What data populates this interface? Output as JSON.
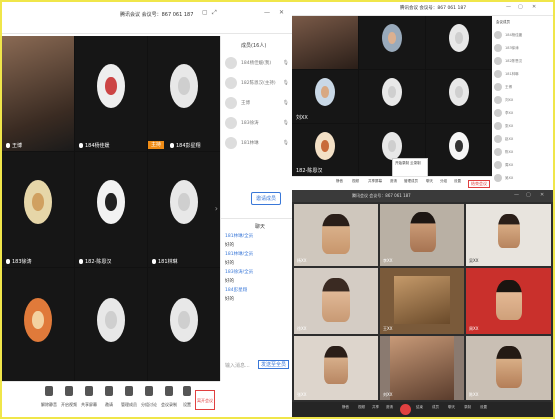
{
  "left_window": {
    "title": "腾讯会议 会议号：867 061 187",
    "controls": [
      "▢",
      "⤢",
      "—",
      "✕"
    ],
    "tiles": [
      {
        "name": "王博"
      },
      {
        "name": "184杨佳媛"
      },
      {
        "name": "184彭星翔"
      },
      {
        "name": "183徐涛"
      },
      {
        "name": "182-陈恩汉"
      },
      {
        "name": "181林琳"
      },
      {
        "name": ""
      },
      {
        "name": ""
      },
      {
        "name": ""
      }
    ],
    "host_badge": "主持",
    "participants_header": "成员(16人)",
    "participants": [
      {
        "name": "184杨佳媛(我)",
        "icon": "mic-icon"
      },
      {
        "name": "182陈恩汉(主持)",
        "icon": "mic-icon"
      },
      {
        "name": "王博",
        "icon": "mic-icon"
      },
      {
        "name": "183徐涛",
        "icon": "mic-icon"
      },
      {
        "name": "181林琳",
        "icon": "mic-icon"
      }
    ],
    "more_button": "邀请成员",
    "chat_header": "聊天",
    "chat_lines": [
      {
        "type": "u",
        "text": "181林琳/全员"
      },
      {
        "type": "m",
        "text": "好的"
      },
      {
        "type": "u",
        "text": "181林琳/全员"
      },
      {
        "type": "m",
        "text": "好的"
      },
      {
        "type": "u",
        "text": "183徐涛/全员"
      },
      {
        "type": "m",
        "text": "好的"
      },
      {
        "type": "u",
        "text": "184彭星翔"
      },
      {
        "type": "m",
        "text": "好的"
      }
    ],
    "chat_input_placeholder": "输入消息...",
    "chat_send": "发送至全员",
    "toolbar": [
      {
        "label": "解除静音",
        "icon": "mic-icon"
      },
      {
        "label": "开启视频",
        "icon": "camera-icon"
      },
      {
        "label": "共享屏幕",
        "icon": "share-icon"
      },
      {
        "label": "邀请",
        "icon": "invite-icon"
      },
      {
        "label": "管理成员",
        "icon": "members-icon"
      },
      {
        "label": "分组讨论",
        "icon": "group-icon"
      },
      {
        "label": "会议录制",
        "icon": "record-icon"
      },
      {
        "label": "设置",
        "icon": "settings-icon"
      }
    ],
    "end_button": "离开会议"
  },
  "top_right_window": {
    "title": "腾讯会议 会议号：867 061 187",
    "tiles": [
      {
        "name": ""
      },
      {
        "name": ""
      },
      {
        "name": ""
      },
      {
        "name": "刘XX"
      },
      {
        "name": ""
      },
      {
        "name": ""
      },
      {
        "name": "182-陈恩汉"
      },
      {
        "name": ""
      },
      {
        "name": ""
      }
    ],
    "side_list": [
      "会议成员",
      "184杨佳媛",
      "183徐涛",
      "182陈恩汉",
      "181林琳",
      "王博",
      "刘XX",
      "李XX",
      "张XX",
      "赵XX",
      "陈XX",
      "周XX",
      "吴XX"
    ],
    "toolbar": [
      "静音",
      "视频",
      "共享屏幕",
      "邀请",
      "管理成员",
      "聊天",
      "分组",
      "设置"
    ],
    "end_button": "结束会议",
    "tooltip": "开始录制 云录制"
  },
  "bottom_right_window": {
    "title": "腾讯会议 会议号：867 061 187",
    "tiles": [
      {
        "name": "杨XX"
      },
      {
        "name": "李XX"
      },
      {
        "name": "吴XX"
      },
      {
        "name": "徐XX"
      },
      {
        "name": "王XX"
      },
      {
        "name": "周XX"
      },
      {
        "name": "张XX"
      },
      {
        "name": "刘XX"
      },
      {
        "name": "陈XX"
      }
    ],
    "toolbar": [
      "静音",
      "视频",
      "共享",
      "邀请",
      "结束",
      "成员",
      "聊天",
      "录制",
      "设置"
    ]
  }
}
